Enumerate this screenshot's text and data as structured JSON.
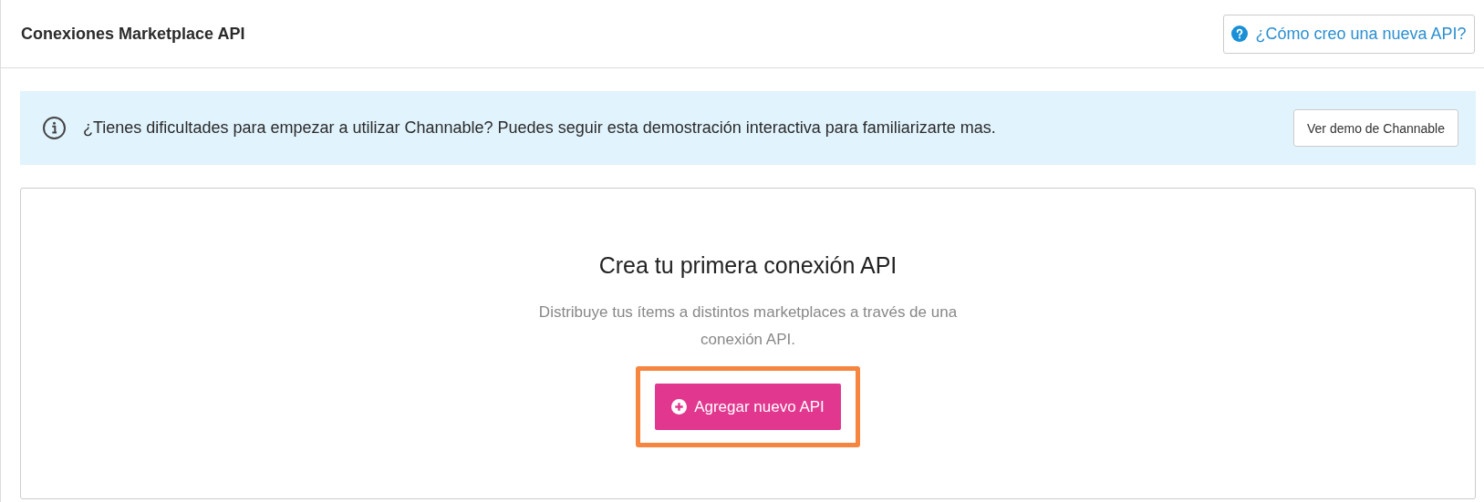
{
  "header": {
    "title": "Conexiones Marketplace API",
    "help_button": {
      "label": "¿Cómo creo una nueva API?"
    }
  },
  "banner": {
    "message": "¿Tienes dificultades para empezar a utilizar Channable? Puedes seguir esta demostración interactiva para familiarizarte mas.",
    "button": "Ver demo de Channable"
  },
  "empty_state": {
    "heading": "Crea tu primera conexión API",
    "description": "Distribuye tus ítems a distintos marketplaces a través de una conexión API.",
    "button": {
      "label": "Agregar nuevo API",
      "highlighted": true
    }
  }
}
